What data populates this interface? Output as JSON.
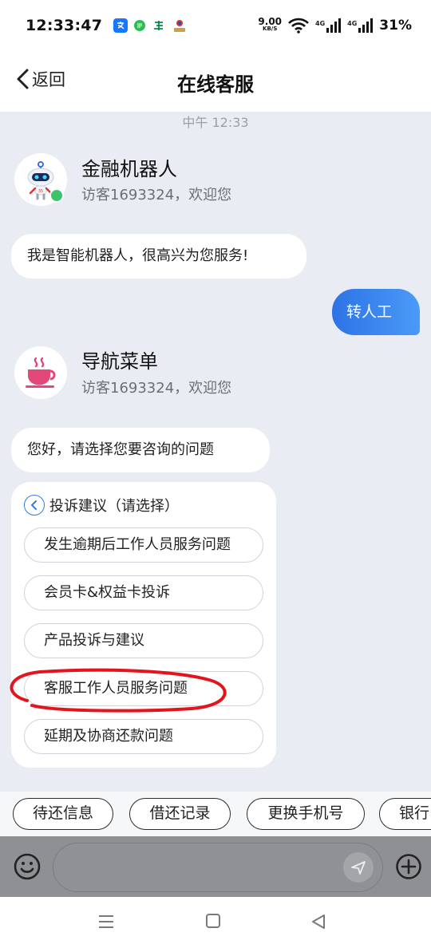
{
  "status_bar": {
    "time": "12:33:47",
    "net_speed": "9.00",
    "net_speed_unit": "KB/S",
    "sig1_label": "4G",
    "sig2_label": "4G",
    "battery": "31%"
  },
  "header": {
    "back_label": "返回",
    "title": "在线客服"
  },
  "chat": {
    "timestamp": "中午 12:33",
    "bot1": {
      "name": "金融机器人",
      "subtitle": "访客1693324，欢迎您",
      "message": "我是智能机器人，很高兴为您服务!"
    },
    "user_message": "转人工",
    "bot2": {
      "name": "导航菜单",
      "subtitle": "访客1693324，欢迎您",
      "message": "您好，请选择您要咨询的问题"
    },
    "menu": {
      "header": "投诉建议（请选择）",
      "options": [
        "发生逾期后工作人员服务问题",
        "会员卡&权益卡投诉",
        "产品投诉与建议",
        "客服工作人员服务问题",
        "延期及协商还款问题"
      ]
    }
  },
  "quick_actions": [
    "待还信息",
    "借还记录",
    "更换手机号",
    "银行"
  ],
  "colors": {
    "accent": "#2f7de5",
    "online": "#3bc46a",
    "annotation": "#e4141c"
  }
}
